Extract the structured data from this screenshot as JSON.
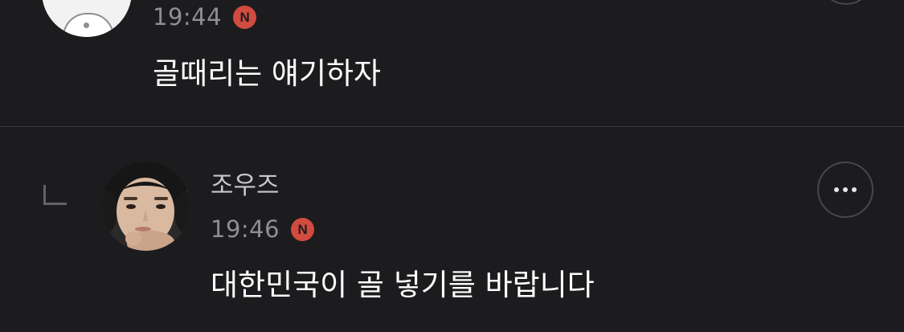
{
  "comments": [
    {
      "time": "19:44",
      "badge": "N",
      "text": "골때리는 얘기하자"
    },
    {
      "author": "조우즈",
      "time": "19:46",
      "badge": "N",
      "text": "대한민국이 골 넣기를 바랍니다",
      "is_reply": true
    }
  ],
  "colors": {
    "background": "#1c1c1e",
    "badge": "#d14b3f",
    "timestamp": "#8e8e93",
    "divider": "#3a3a3c"
  },
  "icons": {
    "reply": "reply-indent-icon",
    "more": "more-dots-icon",
    "new_badge": "new-badge-icon"
  }
}
